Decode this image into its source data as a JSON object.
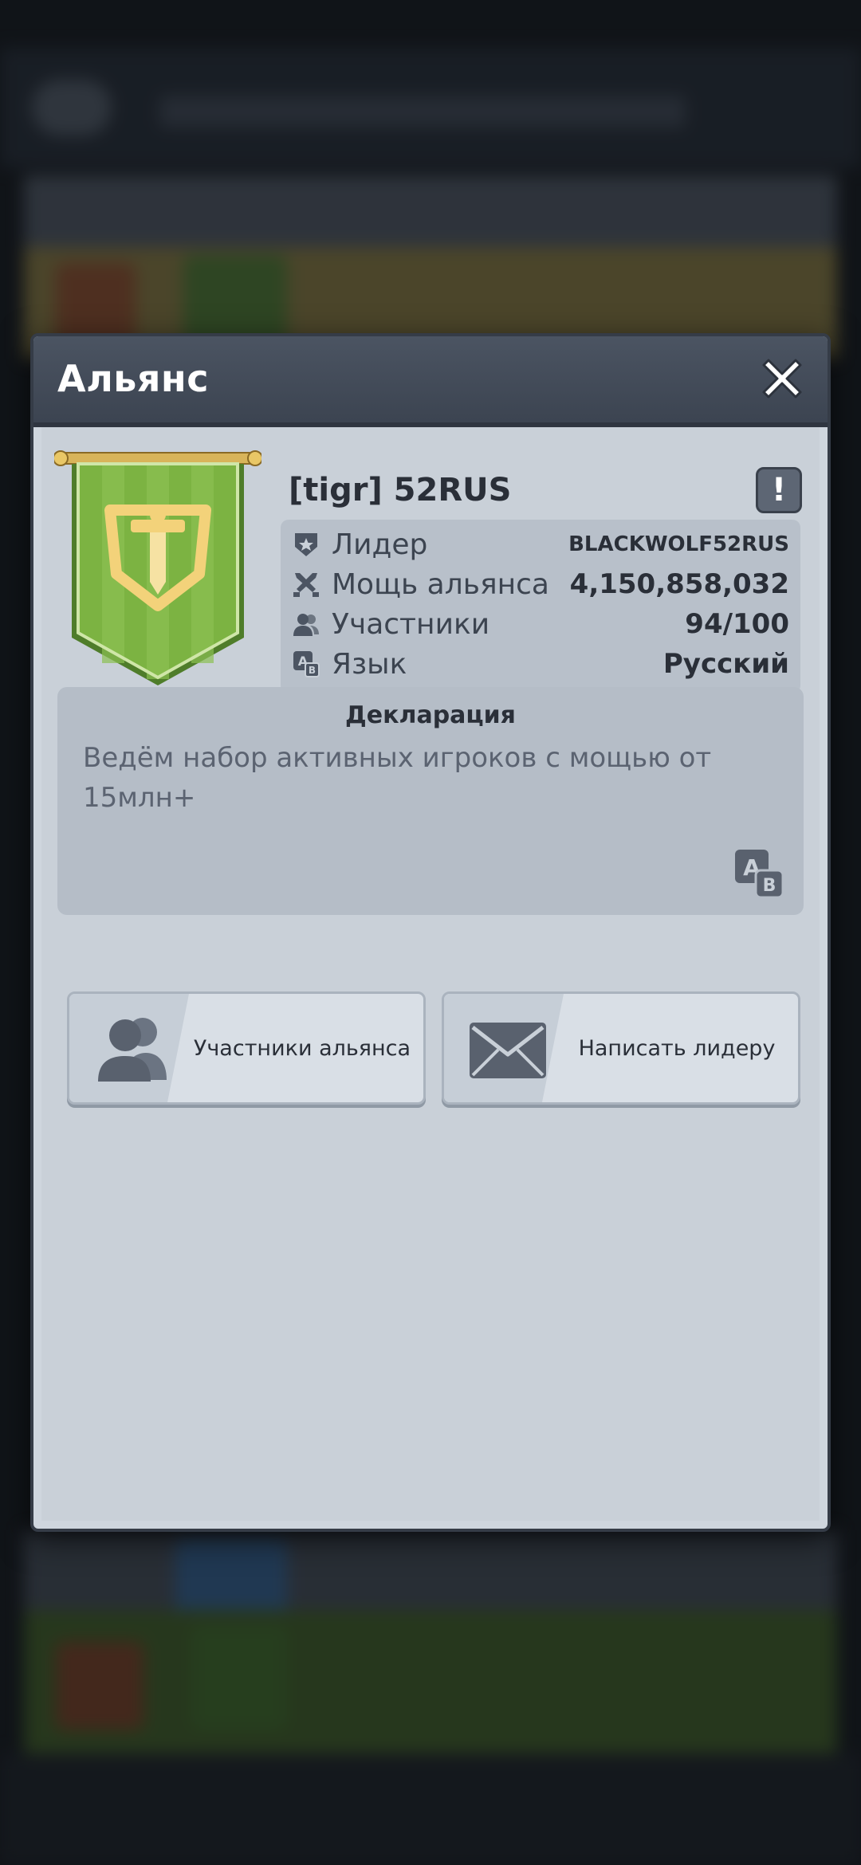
{
  "dialog": {
    "title": "Альянс"
  },
  "alliance": {
    "name": "[tigr] 52RUS",
    "report_glyph": "!",
    "info": [
      {
        "icon": "leader-badge-icon",
        "label": "Лидер",
        "value": "BLACKWOLF52RUS"
      },
      {
        "icon": "crossed-swords-icon",
        "label": "Мощь альянса",
        "value": "4,150,858,032"
      },
      {
        "icon": "members-icon",
        "label": "Участники",
        "value": "94/100"
      },
      {
        "icon": "language-icon",
        "label": "Язык",
        "value": "Русский"
      }
    ]
  },
  "declaration": {
    "title": "Декларация",
    "text": "Ведём набор активных игроков с мощью от 15млн+"
  },
  "actions": {
    "members_label": "Участники альянса",
    "mail_label": "Написать лидеру"
  },
  "colors": {
    "banner_green": "#7cb342",
    "emblem_gold": "#f3d27a",
    "header": "#434b58"
  }
}
